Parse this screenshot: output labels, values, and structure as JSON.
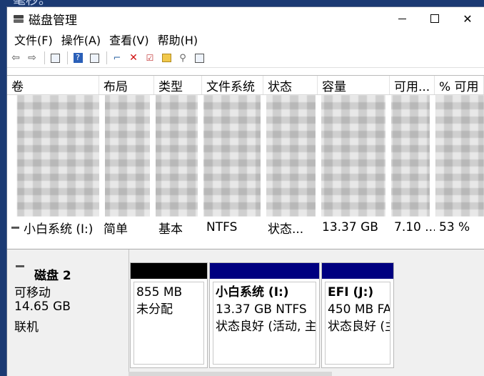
{
  "background_text": "毫秒。",
  "window": {
    "title": "磁盘管理"
  },
  "menu": [
    {
      "label": "文件(F)"
    },
    {
      "label": "操作(A)"
    },
    {
      "label": "查看(V)"
    },
    {
      "label": "帮助(H)"
    }
  ],
  "columns": [
    "卷",
    "布局",
    "类型",
    "文件系统",
    "状态",
    "容量",
    "可用...",
    "% 可用"
  ],
  "volume_row": {
    "name": "小白系统 (I:)",
    "layout": "简单",
    "type": "基本",
    "fs": "NTFS",
    "status": "状态...",
    "capacity": "13.37 GB",
    "free": "7.10 ...",
    "pct": "53 %"
  },
  "disk": {
    "name": "磁盘 2",
    "kind": "可移动",
    "size": "14.65 GB",
    "state": "联机"
  },
  "partitions": [
    {
      "title": "",
      "line1": "855 MB",
      "line2": "未分配",
      "bar_color": "#000000"
    },
    {
      "title": "小白系统  (I:)",
      "line1": "13.37 GB NTFS",
      "line2": "状态良好 (活动, 主",
      "bar_color": "#000080"
    },
    {
      "title": "EFI  (J:)",
      "line1": "450 MB FA",
      "line2": "状态良好 (主",
      "bar_color": "#000080"
    }
  ],
  "colors": {
    "unallocated": "#000000",
    "primary": "#000080",
    "accent": "#1b3a73"
  }
}
